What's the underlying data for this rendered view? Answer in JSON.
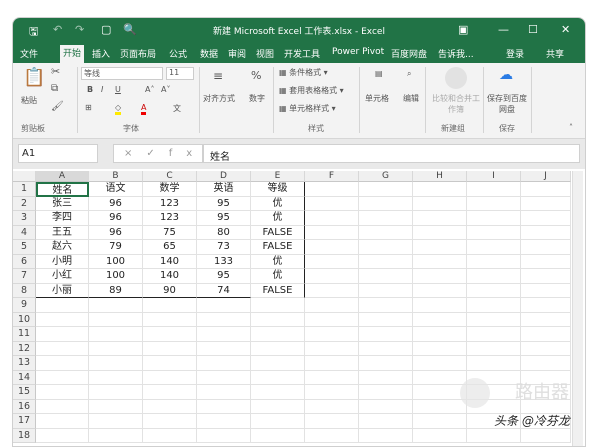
{
  "window": {
    "title": "新建 Microsoft Excel 工作表.xlsx - Excel"
  },
  "tabs": [
    "文件",
    "开始",
    "插入",
    "页面布局",
    "公式",
    "数据",
    "审阅",
    "视图",
    "开发工具",
    "Power Pivot",
    "百度网盘"
  ],
  "tell_me": "告诉我...",
  "login": "登录",
  "share": "共享",
  "ribbon": {
    "paste": "粘贴",
    "clipboard_group": "剪贴板",
    "font_name": "等线",
    "font_size": "11",
    "bold": "B",
    "italic": "I",
    "underline": "U",
    "font_group": "字体",
    "alignment": "对齐方式",
    "number": "数字",
    "conditional_format": "条件格式",
    "table_format": "套用表格格式",
    "cell_style": "单元格样式",
    "styles_group": "样式",
    "cells": "单元格",
    "editing": "编辑",
    "compare_merge": "比较和合并工作簿",
    "new_group": "新建组",
    "save_baidu": "保存到百度网盘",
    "save_group": "保存"
  },
  "formula_bar": {
    "name_box": "A1",
    "fx": "×✓fx",
    "value": "姓名"
  },
  "columns": [
    "A",
    "B",
    "C",
    "D",
    "E",
    "F",
    "G",
    "H",
    "I",
    "J"
  ],
  "rows": [
    [
      "姓名",
      "语文",
      "数学",
      "英语",
      "等级"
    ],
    [
      "张三",
      "96",
      "123",
      "95",
      "优"
    ],
    [
      "李四",
      "96",
      "123",
      "95",
      "优"
    ],
    [
      "王五",
      "96",
      "75",
      "80",
      "FALSE"
    ],
    [
      "赵六",
      "79",
      "65",
      "73",
      "FALSE"
    ],
    [
      "小明",
      "100",
      "140",
      "133",
      "优"
    ],
    [
      "小红",
      "100",
      "140",
      "95",
      "优"
    ],
    [
      "小丽",
      "89",
      "90",
      "74",
      "FALSE"
    ]
  ],
  "row_count": 18,
  "watermark": {
    "logo": "路由器",
    "credit": "头条 @冷芬龙"
  },
  "colors": {
    "accent": "#217346"
  }
}
